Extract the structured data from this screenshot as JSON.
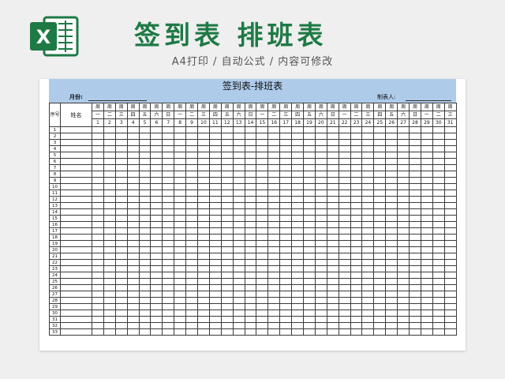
{
  "header": {
    "app_icon": "excel-icon",
    "app_icon_letter": "X",
    "brand_color": "#1e7a45",
    "title": "签到表 排班表",
    "subtitle": "A4打印 / 自动公式 / 内容可修改"
  },
  "sheet": {
    "title": "签到表-排班表",
    "month_label": "月份:",
    "maker_label": "制表人:",
    "header_fill": "#aecbea",
    "col_seq": "序号",
    "col_name": "姓名",
    "week_prefix": "周",
    "weekdays": [
      "一",
      "二",
      "三",
      "四",
      "五",
      "六",
      "日",
      "一",
      "二",
      "三",
      "四",
      "五",
      "六",
      "日",
      "一",
      "二",
      "三",
      "四",
      "五",
      "六",
      "日",
      "一",
      "二",
      "三",
      "四",
      "五",
      "六",
      "日",
      "一",
      "二",
      "三"
    ],
    "days": [
      "1",
      "2",
      "3",
      "4",
      "5",
      "6",
      "7",
      "8",
      "9",
      "10",
      "11",
      "12",
      "13",
      "14",
      "15",
      "16",
      "17",
      "18",
      "19",
      "20",
      "21",
      "22",
      "23",
      "24",
      "25",
      "26",
      "27",
      "28",
      "29",
      "30",
      "31"
    ],
    "rows": [
      "1",
      "2",
      "3",
      "4",
      "5",
      "6",
      "7",
      "8",
      "9",
      "10",
      "11",
      "12",
      "13",
      "14",
      "15",
      "16",
      "17",
      "18",
      "19",
      "20",
      "21",
      "22",
      "23",
      "24",
      "25",
      "26",
      "27",
      "28",
      "29",
      "30",
      "31",
      "32",
      "33"
    ]
  }
}
